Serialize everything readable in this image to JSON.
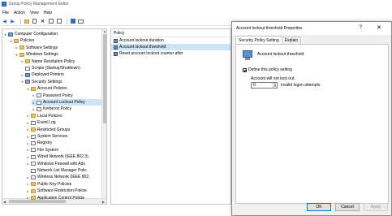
{
  "window": {
    "title": "Group Policy Management Editor"
  },
  "menu": [
    "File",
    "Action",
    "View",
    "Help"
  ],
  "toolbar": {
    "icons": [
      "back-icon",
      "forward-icon",
      "folder-icon",
      "properties-icon",
      "delete-icon",
      "refresh-icon",
      "export-icon",
      "help-icon",
      "console-icon"
    ]
  },
  "tree": {
    "items": [
      {
        "label": "Computer Configuration",
        "icon": "computer-icon",
        "expander": "v",
        "indent": 0
      },
      {
        "label": "Policies",
        "icon": "folder-icon",
        "expander": "v",
        "indent": 1
      },
      {
        "label": "Software Settings",
        "icon": "folder-icon",
        "expander": ">",
        "indent": 2
      },
      {
        "label": "Windows Settings",
        "icon": "folder-icon",
        "expander": "v",
        "indent": 2
      },
      {
        "label": "Name Resolution Policy",
        "icon": "folder-icon",
        "expander": ">",
        "indent": 3
      },
      {
        "label": "Scripts (Startup/Shutdown)",
        "icon": "doc-icon",
        "expander": "",
        "indent": 3
      },
      {
        "label": "Deployed Printers",
        "icon": "printer-icon",
        "expander": ">",
        "indent": 3
      },
      {
        "label": "Security Settings",
        "icon": "lock-icon",
        "expander": "v",
        "indent": 3
      },
      {
        "label": "Account Policies",
        "icon": "folder-icon",
        "expander": "v",
        "indent": 4
      },
      {
        "label": "Password Policy",
        "icon": "doc-icon",
        "expander": ">",
        "indent": 5
      },
      {
        "label": "Account Lockout Policy",
        "icon": "doc-icon",
        "expander": ">",
        "indent": 5,
        "selected": true
      },
      {
        "label": "Kerberos Policy",
        "icon": "doc-icon",
        "expander": ">",
        "indent": 5
      },
      {
        "label": "Local Policies",
        "icon": "folder-icon",
        "expander": ">",
        "indent": 4
      },
      {
        "label": "Event Log",
        "icon": "doc-icon",
        "expander": ">",
        "indent": 4
      },
      {
        "label": "Restricted Groups",
        "icon": "folder-icon",
        "expander": ">",
        "indent": 4
      },
      {
        "label": "System Services",
        "icon": "doc-icon",
        "expander": ">",
        "indent": 4
      },
      {
        "label": "Registry",
        "icon": "doc-icon",
        "expander": ">",
        "indent": 4
      },
      {
        "label": "File System",
        "icon": "doc-icon",
        "expander": ">",
        "indent": 4
      },
      {
        "label": "Wired Network (IEEE 802.3)",
        "icon": "doc-icon",
        "expander": ">",
        "indent": 4
      },
      {
        "label": "Windows Firewall with Adv",
        "icon": "doc-icon",
        "expander": ">",
        "indent": 4
      },
      {
        "label": "Network List Manager Polic",
        "icon": "doc-icon",
        "expander": "",
        "indent": 4
      },
      {
        "label": "Wireless Network (IEEE 802.",
        "icon": "doc-icon",
        "expander": ">",
        "indent": 4
      },
      {
        "label": "Public Key Policies",
        "icon": "folder-icon",
        "expander": ">",
        "indent": 4
      },
      {
        "label": "Software Restriction Policie",
        "icon": "folder-icon",
        "expander": ">",
        "indent": 4
      },
      {
        "label": "Application Control Policie",
        "icon": "folder-icon",
        "expander": ">",
        "indent": 4
      }
    ]
  },
  "policies": {
    "header": "Policy",
    "items": [
      {
        "label": "Account lockout duration"
      },
      {
        "label": "Account lockout threshold",
        "selected": true
      },
      {
        "label": "Reset account lockout counter after"
      }
    ]
  },
  "dialog": {
    "title": "Account lockout threshold Properties",
    "help": "?",
    "close": "✕",
    "tabs": [
      "Security Policy Setting",
      "Explain"
    ],
    "policy_name": "Account lockout threshold",
    "define_label": "Define this policy setting",
    "define_checked": true,
    "lockout_label": "Account will not lock out.",
    "value": "0",
    "value_suffix": "invalid logon attempts",
    "buttons": {
      "ok": "OK",
      "cancel": "Cancel",
      "apply": "Apply"
    }
  }
}
